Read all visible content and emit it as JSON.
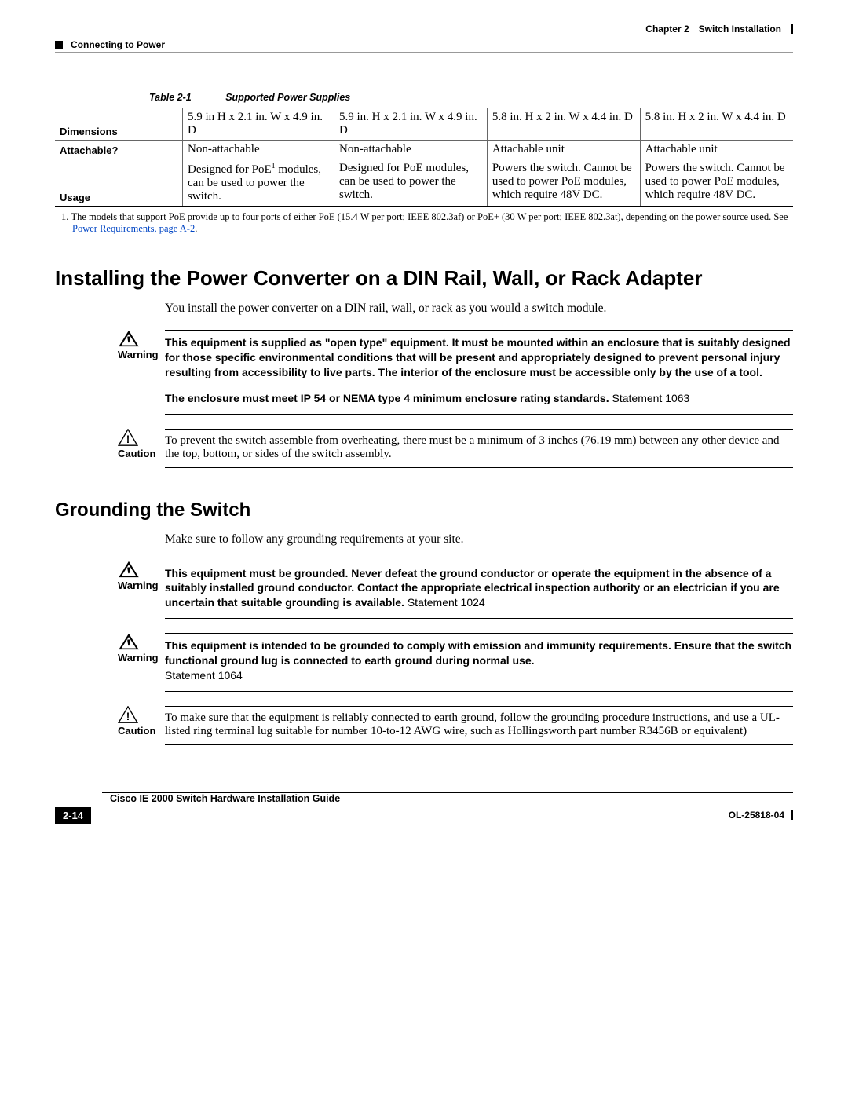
{
  "header": {
    "chapter_label": "Chapter 2",
    "chapter_title": "Switch Installation",
    "section": "Connecting to Power"
  },
  "table": {
    "number": "Table 2-1",
    "title": "Supported Power Supplies",
    "rows": {
      "dimensions": {
        "label": "Dimensions",
        "c1": "5.9 in H x 2.1 in. W x 4.9 in. D",
        "c2": "5.9 in. H x 2.1 in. W x 4.9 in. D",
        "c3": "5.8 in. H x 2 in. W x 4.4 in. D",
        "c4": "5.8 in. H x 2 in. W x 4.4 in. D"
      },
      "attachable": {
        "label": "Attachable?",
        "c1": "Non-attachable",
        "c2": "Non-attachable",
        "c3": "Attachable unit",
        "c4": "Attachable unit"
      },
      "usage": {
        "label": "Usage",
        "c1_pre": "Designed for PoE",
        "c1_sup": "1",
        "c1_post": " modules, can be used to power the switch.",
        "c2": "Designed for PoE modules, can be used to power the switch.",
        "c3": "Powers the switch. Cannot be used to power PoE modules, which require 48V DC.",
        "c4": "Powers the switch. Cannot be used to power PoE modules, which require 48V DC."
      }
    },
    "footnote_num": "1.",
    "footnote_text_pre": "The models that support PoE provide up to four ports of either PoE (15.4 W per port; IEEE 802.3af) or PoE+ (30 W per port; IEEE 802.3at), depending on the power source used. See ",
    "footnote_link": "Power Requirements, page A-2",
    "footnote_text_post": "."
  },
  "section1": {
    "heading": "Installing the Power Converter on a DIN Rail, Wall, or Rack Adapter",
    "intro": "You install the power converter on a DIN rail, wall, or rack as you would a switch module.",
    "warning_label": "Warning",
    "warning_p1": "This equipment is supplied as \"open type\" equipment. It must be mounted within an enclosure that is suitably designed for those specific environmental conditions that will be present and appropriately designed to prevent personal injury resulting from accessibility to live parts. The interior of the enclosure must be accessible only by the use of a tool.",
    "warning_p2_bold": "The enclosure must meet IP 54 or NEMA type 4 minimum enclosure rating standards. ",
    "warning_p2_stmt": "Statement 1063",
    "caution_label": "Caution",
    "caution_text": "To prevent the switch assemble from overheating, there must be a minimum of 3 inches (76.19 mm) between any other device and the top, bottom, or sides of the switch assembly."
  },
  "section2": {
    "heading": "Grounding the Switch",
    "intro": "Make sure to follow any grounding requirements at your site.",
    "warning1_bold": "This equipment must be grounded. Never defeat the ground conductor or operate the equipment in the absence of a suitably installed ground conductor. Contact the appropriate electrical inspection authority or an electrician if you are uncertain that suitable grounding is available. ",
    "warning1_stmt": "Statement 1024",
    "warning2_bold": "This equipment is intended to be grounded to comply with emission and immunity requirements. Ensure that the switch functional ground lug is connected to earth ground during normal use. ",
    "warning2_stmt": "Statement 1064",
    "caution_text": "To make sure that the equipment is reliably connected to earth ground, follow the grounding procedure instructions, and use a UL-listed ring terminal lug suitable for number 10-to-12 AWG wire, such as Hollingsworth part number R3456B or equivalent)"
  },
  "labels": {
    "warning": "Warning",
    "caution": "Caution"
  },
  "footer": {
    "guide_title": "Cisco IE 2000 Switch Hardware Installation Guide",
    "page": "2-14",
    "ol": "OL-25818-04"
  }
}
